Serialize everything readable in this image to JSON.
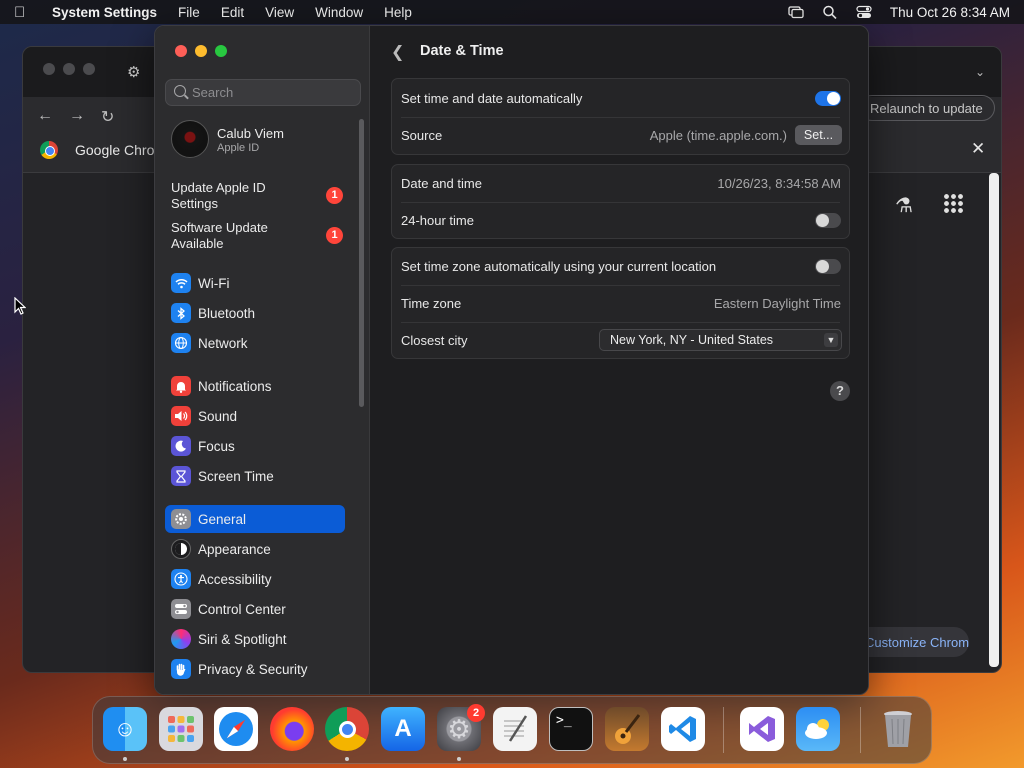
{
  "menubar": {
    "app_name": "System Settings",
    "menus": [
      "File",
      "Edit",
      "View",
      "Window",
      "Help"
    ],
    "datetime": "Thu Oct 26  8:34 AM"
  },
  "chrome": {
    "bookmark_label": "Google Chrome",
    "relaunch_label": "Relaunch to update",
    "customize_label": "Customize Chrome"
  },
  "sidebar": {
    "search_placeholder": "Search",
    "account": {
      "name": "Calub Viem",
      "subtitle": "Apple ID"
    },
    "notices": [
      {
        "label": "Update Apple ID Settings",
        "badge": "1"
      },
      {
        "label": "Software Update Available",
        "badge": "1"
      }
    ],
    "items": [
      {
        "label": "Wi-Fi",
        "icon": "wifi-icon",
        "color": "#1e82f0"
      },
      {
        "label": "Bluetooth",
        "icon": "bluetooth-icon",
        "color": "#1e82f0"
      },
      {
        "label": "Network",
        "icon": "globe-icon",
        "color": "#1e82f0"
      },
      {
        "label": "Notifications",
        "icon": "bell-icon",
        "color": "#f0413a"
      },
      {
        "label": "Sound",
        "icon": "speaker-icon",
        "color": "#f0413a"
      },
      {
        "label": "Focus",
        "icon": "moon-icon",
        "color": "#5b55d6"
      },
      {
        "label": "Screen Time",
        "icon": "hourglass-icon",
        "color": "#5b55d6"
      },
      {
        "label": "General",
        "icon": "gear-icon",
        "color": "#8e8e93"
      },
      {
        "label": "Appearance",
        "icon": "appearance-icon",
        "color": "#1c1c1e"
      },
      {
        "label": "Accessibility",
        "icon": "accessibility-icon",
        "color": "#1e82f0"
      },
      {
        "label": "Control Center",
        "icon": "control-center-icon",
        "color": "#8e8e93"
      },
      {
        "label": "Siri & Spotlight",
        "icon": "siri-icon",
        "color": "#c23bd4"
      },
      {
        "label": "Privacy & Security",
        "icon": "hand-icon",
        "color": "#1e82f0"
      }
    ],
    "selected": "General"
  },
  "content": {
    "title": "Date & Time",
    "auto_time": {
      "label": "Set time and date automatically",
      "on": true
    },
    "source": {
      "label": "Source",
      "value": "Apple (time.apple.com.)",
      "button": "Set..."
    },
    "date_time": {
      "label": "Date and time",
      "value": "10/26/23, 8:34:58 AM"
    },
    "hour24": {
      "label": "24-hour time",
      "on": false
    },
    "auto_tz": {
      "label": "Set time zone automatically using your current location",
      "on": false
    },
    "time_zone": {
      "label": "Time zone",
      "value": "Eastern Daylight Time"
    },
    "closest_city": {
      "label": "Closest city",
      "value": "New York, NY - United States"
    },
    "help": "?"
  },
  "dock": {
    "apps": [
      "Finder",
      "Launchpad",
      "Safari",
      "Firefox",
      "Google Chrome",
      "App Store",
      "System Settings",
      "TextEdit",
      "Terminal",
      "GarageBand",
      "Visual Studio Code",
      "Visual Studio",
      "Weather",
      "Trash"
    ],
    "settings_badge": "2"
  },
  "colors": {
    "accent": "#0b5cd6",
    "toggle_on": "#1e74e8",
    "badge": "#ff453a"
  }
}
